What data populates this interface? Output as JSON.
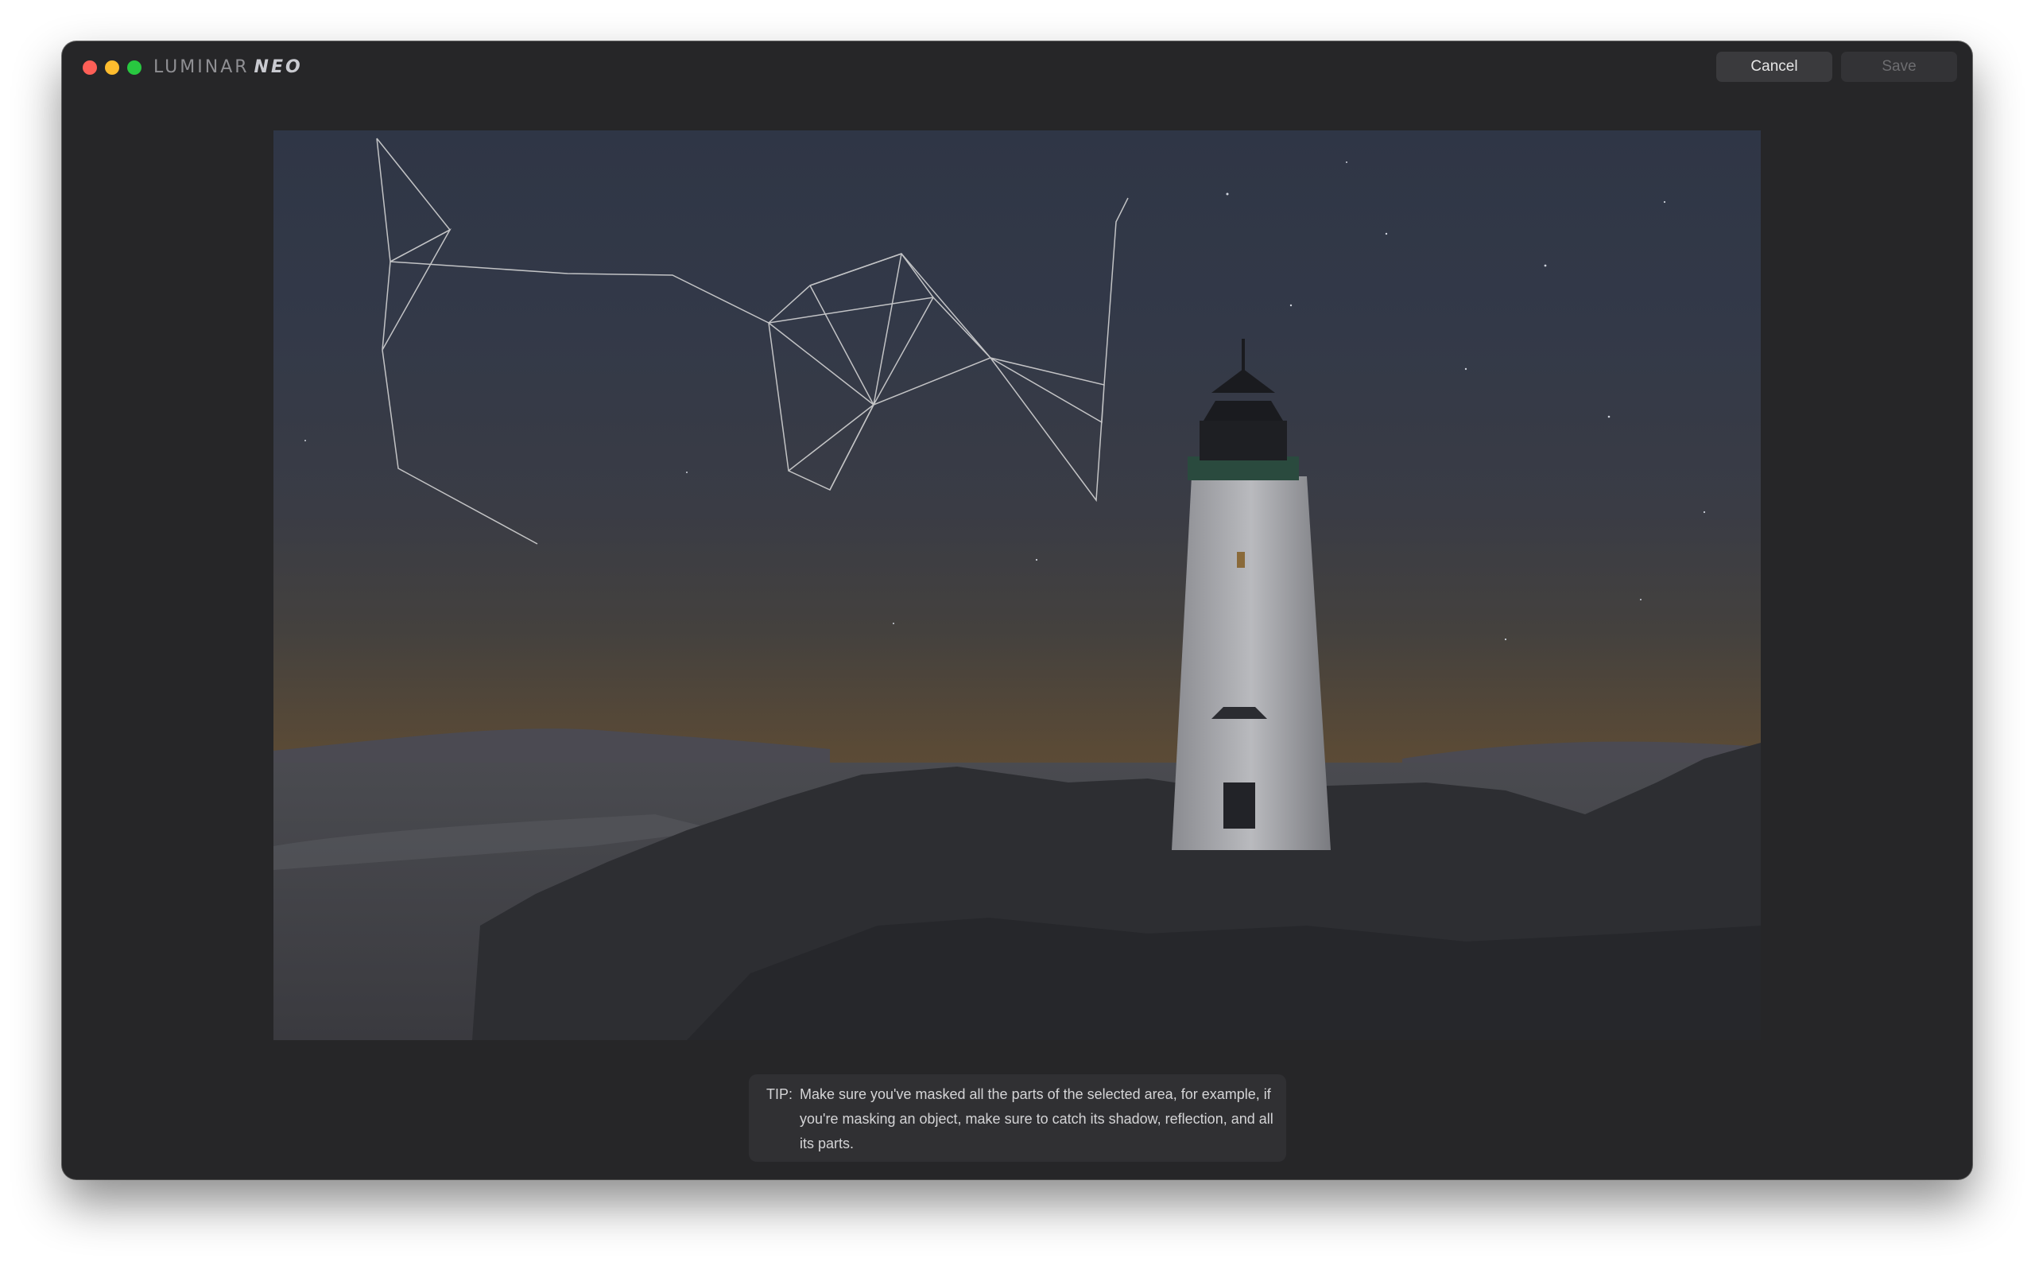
{
  "app": {
    "brand_light": "LUMINAR",
    "brand_bold": "NEO"
  },
  "toolbar": {
    "cancel_label": "Cancel",
    "save_label": "Save"
  },
  "tip": {
    "label": "TIP:",
    "text": "Make sure you've masked all the parts of the selected area, for example, if you're masking an object, make sure to catch its shadow, reflection, and all its parts."
  },
  "colors": {
    "window_bg": "#262628",
    "close": "#fe5f57",
    "minimize": "#febc2e",
    "maximize": "#28c840"
  },
  "icons": {
    "close": "close-dot-icon",
    "minimize": "minimize-dot-icon",
    "maximize": "maximize-dot-icon"
  }
}
